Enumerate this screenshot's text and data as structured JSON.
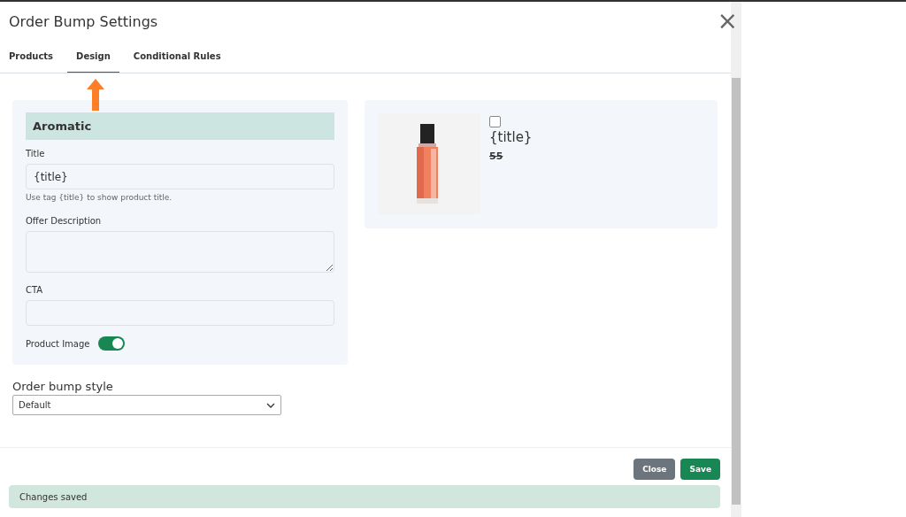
{
  "window": {
    "title": "Order Bump Settings",
    "close_icon": "×"
  },
  "tabs": [
    {
      "label": "Products",
      "selected": false
    },
    {
      "label": "Design",
      "selected": true
    },
    {
      "label": "Conditional Rules",
      "selected": false
    }
  ],
  "form": {
    "heading": "Aromatic",
    "title": {
      "label": "Title",
      "value": "{title}",
      "hint": "Use tag {title} to show product title."
    },
    "offer_description": {
      "label": "Offer Description"
    },
    "cta": {
      "label": "CTA"
    },
    "product_image": {
      "label": "Product Image",
      "on": true
    }
  },
  "preview": {
    "checked": false,
    "title": "{title}",
    "price": "55"
  },
  "style": {
    "label": "Order bump style",
    "value": "Default"
  },
  "buttons": [
    {
      "label": "Close",
      "kind": "secondary"
    },
    {
      "label": "Save",
      "kind": "primary"
    }
  ],
  "status": "Changes saved"
}
